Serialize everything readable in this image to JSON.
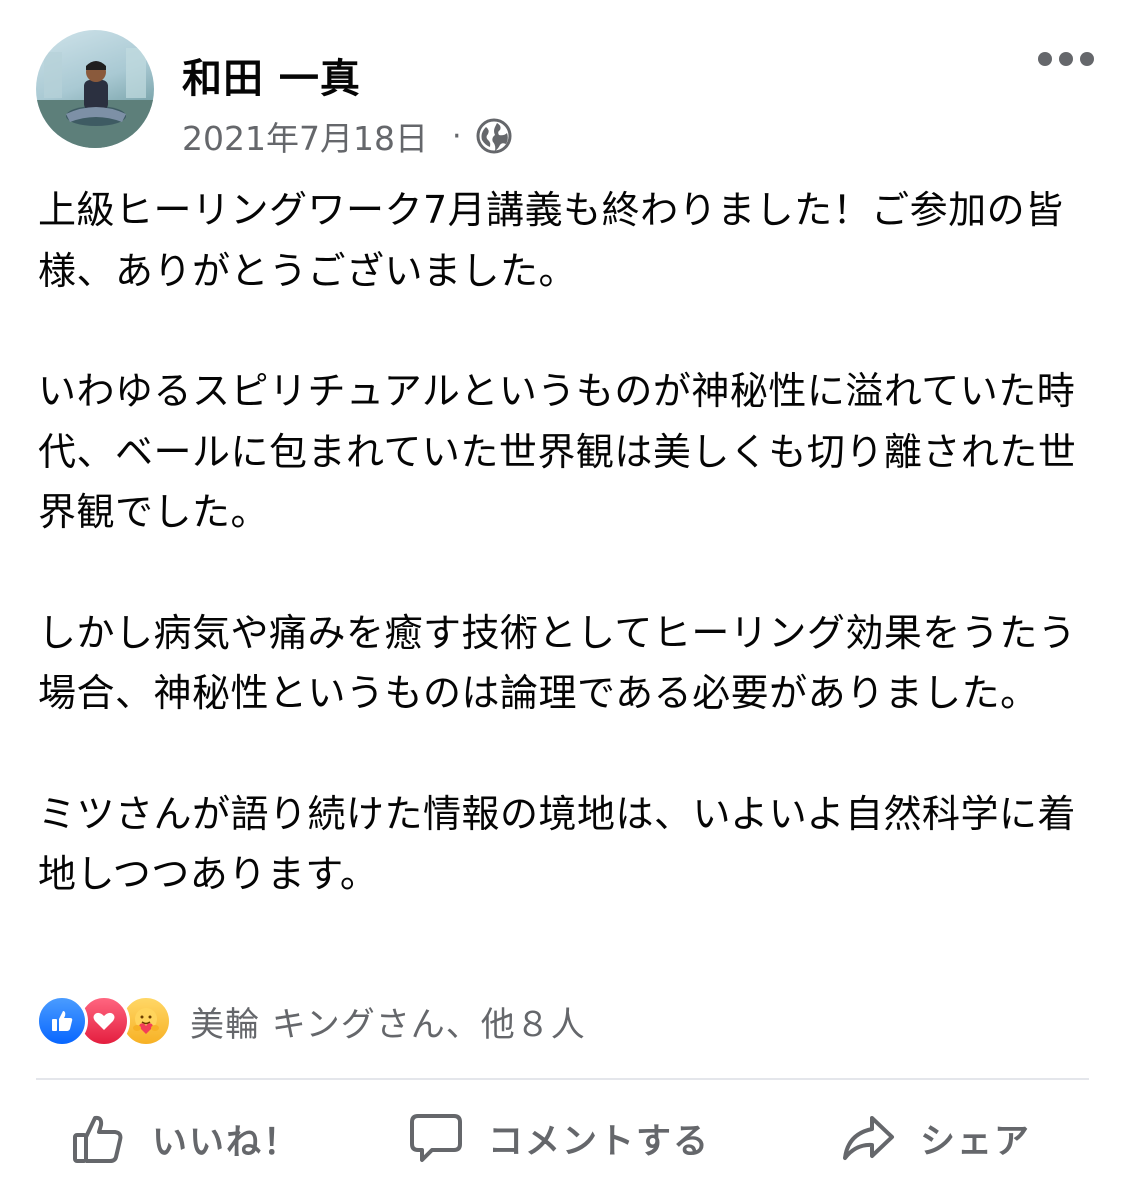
{
  "post": {
    "author": "和田 一真",
    "date": "2021年7月18日",
    "separator": "·",
    "paragraphs": [
      "上級ヒーリングワーク7月講義も終わりました！ご参加の皆様、ありがとうございました。",
      "いわゆるスピリチュアルというものが神秘性に溢れていた時代、ベールに包まれていた世界観は美しくも切り離された世界観でした。",
      "しかし病気や痛みを癒す技術としてヒーリング効果をうたう場合、神秘性というものは論理である必要がありました。",
      "ミツさんが語り続けた情報の境地は、いよいよ自然科学に着地しつつあります。"
    ]
  },
  "reactions": {
    "icons": [
      "like-icon",
      "love-icon",
      "care-icon"
    ],
    "summary": "美輪 キングさん、他８人"
  },
  "actions": {
    "like_label": "いいね！",
    "comment_label": "コメントする",
    "share_label": "シェア"
  },
  "colors": {
    "secondary_text": "#65676b",
    "like_blue": "#0866ff",
    "love_red": "#e41e3f",
    "care_yellow": "#f7b125"
  }
}
